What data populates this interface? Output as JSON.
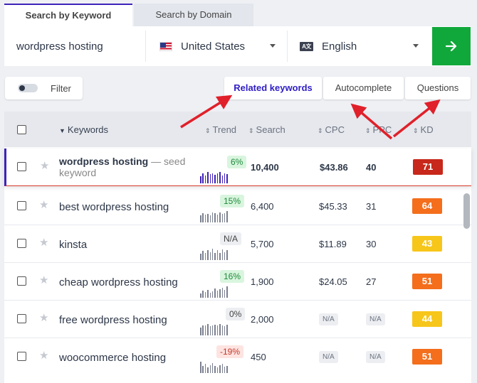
{
  "tabs": {
    "keyword": "Search by Keyword",
    "domain": "Search by Domain"
  },
  "search": {
    "query": "wordpress hosting",
    "country": "United States",
    "language": "English",
    "language_icon_text": "A文"
  },
  "filter": {
    "label": "Filter"
  },
  "segments": {
    "related": "Related keywords",
    "autocomplete": "Autocomplete",
    "questions": "Questions"
  },
  "table": {
    "columns": {
      "keywords": "Keywords",
      "trend": "Trend",
      "search": "Search",
      "cpc": "CPC",
      "ppc": "PPC",
      "kd": "KD"
    },
    "seed_suffix": "— seed keyword",
    "rows": [
      {
        "keyword": "wordpress hosting",
        "trend": "6%",
        "trend_type": "green",
        "search": "10,400",
        "cpc": "$43.86",
        "ppc": "40",
        "kd": "71",
        "kd_color": "#c7281b",
        "spark": [
          0.6,
          0.9,
          0.7,
          1,
          0.8,
          0.9,
          0.75,
          0.85,
          1,
          0.7,
          0.9,
          0.8
        ]
      },
      {
        "keyword": "best wordpress hosting",
        "trend": "15%",
        "trend_type": "green",
        "search": "6,400",
        "cpc": "$45.33",
        "ppc": "31",
        "kd": "64",
        "kd_color": "#f46e1c",
        "spark": [
          0.6,
          0.8,
          0.7,
          0.75,
          0.65,
          0.9,
          0.8,
          0.7,
          0.85,
          0.75,
          0.8,
          1
        ]
      },
      {
        "keyword": "kinsta",
        "trend": "N/A",
        "trend_type": "gray",
        "search": "5,700",
        "cpc": "$11.89",
        "ppc": "30",
        "kd": "43",
        "kd_color": "#f7c61b",
        "spark": [
          0.55,
          0.8,
          0.6,
          0.9,
          0.7,
          1,
          0.6,
          0.85,
          0.65,
          0.95,
          0.7,
          0.9
        ]
      },
      {
        "keyword": "cheap wordpress hosting",
        "trend": "16%",
        "trend_type": "green",
        "search": "1,900",
        "cpc": "$24.05",
        "ppc": "27",
        "kd": "51",
        "kd_color": "#f46e1c",
        "spark": [
          0.4,
          0.6,
          0.5,
          0.7,
          0.45,
          0.55,
          0.8,
          0.6,
          0.75,
          0.9,
          0.7,
          1
        ]
      },
      {
        "keyword": "free wordpress hosting",
        "trend": "0%",
        "trend_type": "gray",
        "search": "2,000",
        "cpc": "N/A",
        "ppc": "N/A",
        "kd": "44",
        "kd_color": "#f7c61b",
        "spark": [
          0.7,
          0.85,
          0.9,
          1,
          0.8,
          0.9,
          0.95,
          0.85,
          1,
          0.9,
          0.8,
          0.95
        ]
      },
      {
        "keyword": "woocommerce hosting",
        "trend": "-19%",
        "trend_type": "red",
        "search": "450",
        "cpc": "N/A",
        "ppc": "N/A",
        "kd": "51",
        "kd_color": "#f46e1c",
        "spark": [
          1,
          0.6,
          0.8,
          0.5,
          0.7,
          0.9,
          0.6,
          0.5,
          0.7,
          0.8,
          0.55,
          0.65
        ]
      }
    ]
  },
  "colors": {
    "accent": "#3f22b8",
    "go_button": "#11a83b",
    "annotation_arrow": "#e0202a"
  }
}
